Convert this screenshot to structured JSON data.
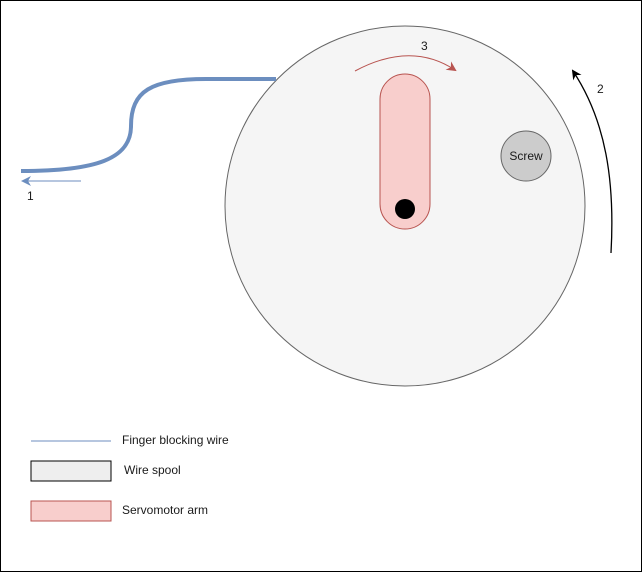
{
  "labels": {
    "arrow_1": "1",
    "arrow_2": "2",
    "arrow_3": "3",
    "screw": "Screw"
  },
  "legend": {
    "wire": "Finger blocking wire",
    "spool": " Wire spool",
    "arm": "Servomotor arm"
  },
  "colors": {
    "wire": "#6c8ebf",
    "spool_fill": "#f5f5f5",
    "spool_stroke": "#666666",
    "arm_fill": "#f8cecc",
    "arm_stroke": "#b85450",
    "screw_fill": "#cccccc",
    "screw_stroke": "#666666",
    "rotation_arrow": "#000000",
    "arm_arrow": "#b85450",
    "pivot": "#000000"
  }
}
